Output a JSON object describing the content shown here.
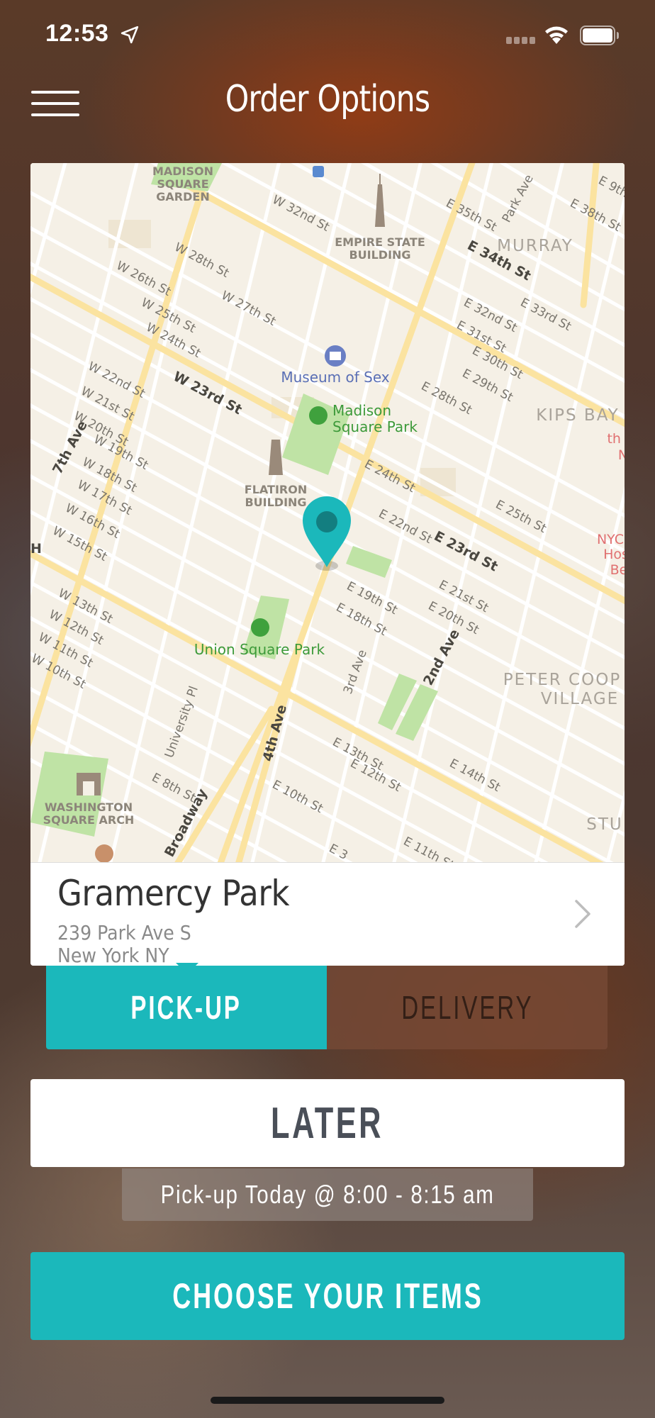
{
  "status_bar": {
    "time": "12:53"
  },
  "header": {
    "title": "Order Options",
    "menu_icon": "hamburger-menu-icon"
  },
  "map": {
    "labels": {
      "madison_square_garden": [
        "MADISON",
        "SQUARE",
        "GARDEN"
      ],
      "empire_state": [
        "EMPIRE STATE",
        "BUILDING"
      ],
      "murray": "MURRAY",
      "museum_of_sex": "Museum of Sex",
      "madison_square_park": [
        "Madison",
        "Square Park"
      ],
      "kips_bay": "KIPS BAY",
      "flatiron": [
        "FLATIRON",
        "BUILDING"
      ],
      "union_square_park": "Union Square Park",
      "peter_cooper": [
        "PETER COOP",
        "VILLAGE"
      ],
      "washington_square_arch": [
        "WASHINGTON",
        "SQUARE ARCH"
      ],
      "nyc_hospital": [
        "NYC",
        "Hos",
        "Be"
      ],
      "stu": "STU",
      "streets": [
        "W 32nd St",
        "E 35th St",
        "Park Ave",
        "E 38th St",
        "E 34th St",
        "W 28th St",
        "W 26th St",
        "W 27th St",
        "W 25th St",
        "W 24th St",
        "E 32nd St",
        "E 33rd St",
        "E 31st St",
        "E 30th St",
        "E 29th St",
        "E 28th St",
        "W 22nd St",
        "W 21st St",
        "W 20th St",
        "W 23rd St",
        "W 19th St",
        "W 18th St",
        "W 17th St",
        "W 16th St",
        "W 15th St",
        "7th Ave",
        "E 24th St",
        "E 22nd St",
        "E 23rd St",
        "E 25th St",
        "E 21st St",
        "E 20th St",
        "E 19th St",
        "E 18th St",
        "W 13th St",
        "W 12th St",
        "W 11th St",
        "W 10th St",
        "3rd Ave",
        "2nd Ave",
        "University Pl",
        "4th Ave",
        "E 13th St",
        "E 14th St",
        "E 12th St",
        "E 8th St",
        "E 10th St",
        "Broadway",
        "E 11th St",
        "E 9th",
        "E 3",
        "th St",
        "N",
        "H"
      ]
    },
    "colors": {
      "land": "#f5f0e6",
      "park": "#bde3a2",
      "major_road": "#fbe9a0",
      "pin": "#1bb8bb"
    }
  },
  "location": {
    "name": "Gramercy Park",
    "address_line1": "239 Park Ave S",
    "address_line2": "New York NY"
  },
  "order_type": {
    "options": [
      {
        "label": "PICK-UP",
        "selected": true
      },
      {
        "label": "DELIVERY",
        "selected": false
      }
    ]
  },
  "timing": {
    "button_label": "LATER",
    "pickup_text": "Pick-up Today @ 8:00 - 8:15 am"
  },
  "cta": {
    "label": "CHOOSE YOUR ITEMS"
  },
  "theme": {
    "accent": "#1bb8bb",
    "text_dark": "#4a4f58"
  }
}
